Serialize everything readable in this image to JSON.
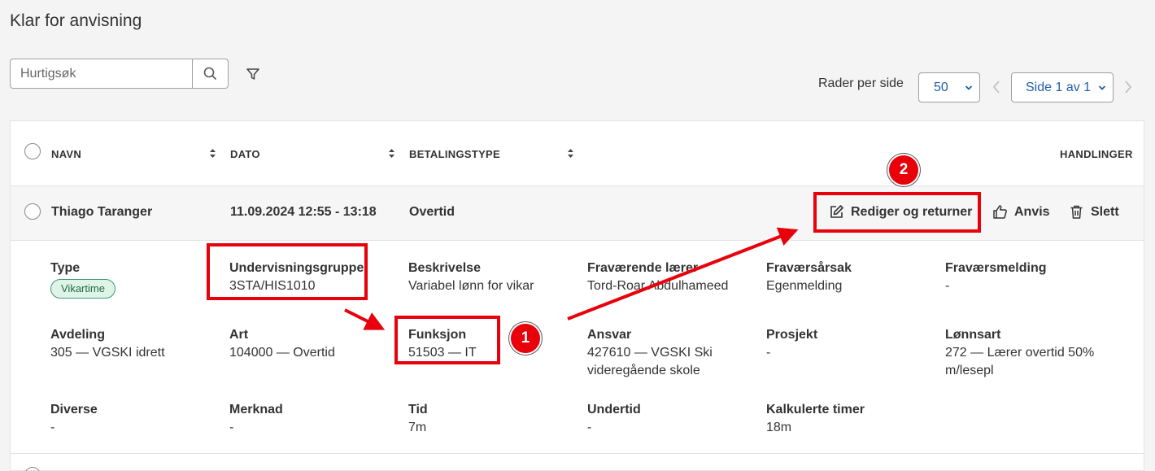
{
  "page": {
    "title": "Klar for anvisning"
  },
  "toolbar": {
    "search_placeholder": "Hurtigsøk",
    "rows_per_page_label": "Rader per side",
    "rows_per_page_value": "50",
    "page_select_value": "Side 1 av 1"
  },
  "table": {
    "headers": {
      "navn": "NAVN",
      "dato": "DATO",
      "betalingstype": "BETALINGSTYPE",
      "handlinger": "HANDLINGER"
    },
    "row": {
      "navn": "Thiago Taranger",
      "dato": "11.09.2024 12:55 - 13:18",
      "betalingstype": "Overtid",
      "actions": {
        "edit": "Rediger og returner",
        "approve": "Anvis",
        "delete": "Slett"
      }
    },
    "details": [
      {
        "label": "Type",
        "badge": "Vikartime"
      },
      {
        "label": "Undervisningsgruppe",
        "value": "3STA/HIS1010"
      },
      {
        "label": "Beskrivelse",
        "value": "Variabel lønn for vikar"
      },
      {
        "label": "Fraværende lærer",
        "value": "Tord-Roar Abdulhameed"
      },
      {
        "label": "Fraværsårsak",
        "value": "Egenmelding"
      },
      {
        "label": "Fraværsmelding",
        "value": "-"
      },
      {
        "label": "Avdeling",
        "value": "305 — VGSKI idrett"
      },
      {
        "label": "Art",
        "value": "104000 — Overtid"
      },
      {
        "label": "Funksjon",
        "value": "51503 — IT"
      },
      {
        "label": "Ansvar",
        "value": "427610 — VGSKI Ski",
        "value2": "videregående skole"
      },
      {
        "label": "Prosjekt",
        "value": "-"
      },
      {
        "label": "Lønnsart",
        "value": "272 — Lærer overtid 50%",
        "value2": "m/lesepl"
      },
      {
        "label": "Diverse",
        "value": "-"
      },
      {
        "label": "Merknad",
        "value": "-"
      },
      {
        "label": "Tid",
        "value": "7m"
      },
      {
        "label": "Undertid",
        "value": "-"
      },
      {
        "label": "Kalkulerte timer",
        "value": "18m"
      }
    ]
  },
  "annotations": {
    "step1": "1",
    "step2": "2"
  },
  "colors": {
    "accent": "#1e5fa8",
    "annotation_red": "#e8000b",
    "badge_green": "#3c9a70"
  }
}
